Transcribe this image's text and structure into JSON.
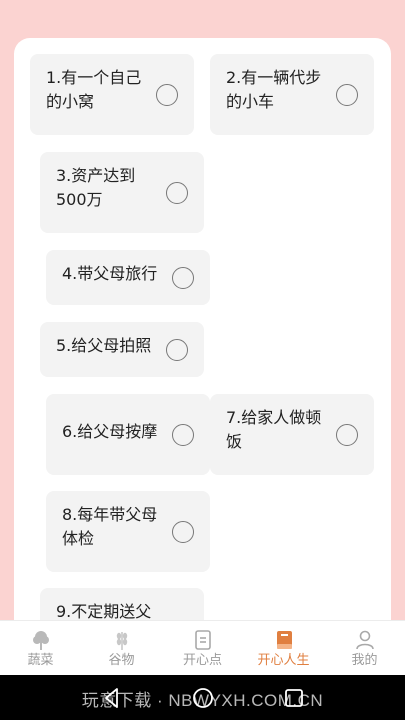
{
  "wishes": [
    {
      "label": "1.有一个自己的小窝",
      "checked": false
    },
    {
      "label": "2.有一辆代步的小车",
      "checked": false
    },
    {
      "label": "3.资产达到500万",
      "checked": false
    },
    {
      "label": "4.带父母旅行",
      "checked": false
    },
    {
      "label": "5.给父母拍照",
      "checked": false
    },
    {
      "label": "6.给父母按摩",
      "checked": false
    },
    {
      "label": "7.给家人做顿饭",
      "checked": false
    },
    {
      "label": "8.每年带父母体检",
      "checked": false
    },
    {
      "label": "9.不定期送父",
      "checked": false
    }
  ],
  "tabbar": {
    "active": "开心人生",
    "active_color": "#e07f40",
    "inactive_color": "#9a9a9a",
    "tabs": [
      {
        "label": "蔬菜",
        "icon": "vegetable-icon"
      },
      {
        "label": "谷物",
        "icon": "grain-icon"
      },
      {
        "label": "开心点",
        "icon": "note-icon"
      },
      {
        "label": "开心人生",
        "icon": "book-icon"
      },
      {
        "label": "我的",
        "icon": "user-icon"
      }
    ]
  },
  "system_nav": {
    "buttons": [
      "back-icon",
      "home-icon",
      "recents-icon"
    ]
  },
  "watermark": "玩意下载 · NBWYXH.COM.CN",
  "colors": {
    "background": "#fbd3d1",
    "card": "#ffffff",
    "item_bg": "#f3f3f3"
  }
}
